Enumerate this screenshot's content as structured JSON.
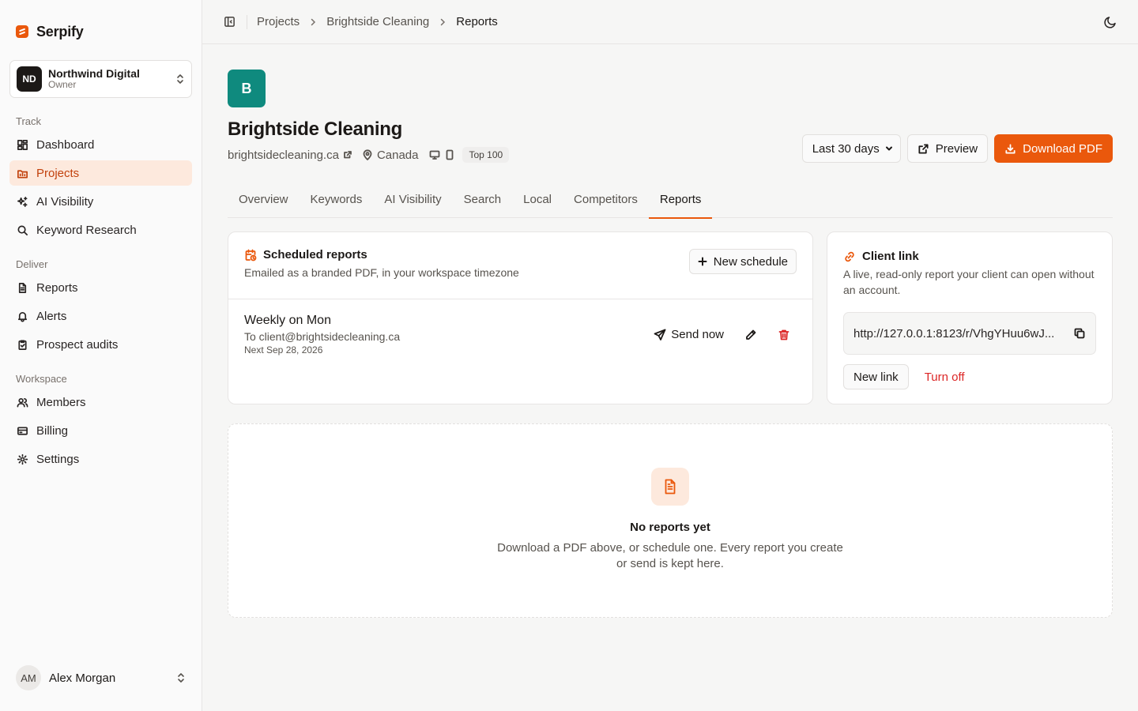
{
  "brand": {
    "name": "Serpify"
  },
  "workspace": {
    "initials": "ND",
    "name": "Northwind Digital",
    "role": "Owner"
  },
  "nav": {
    "track_label": "Track",
    "track": [
      {
        "label": "Dashboard",
        "icon": "dashboard-icon"
      },
      {
        "label": "Projects",
        "icon": "projects-icon",
        "active": true
      },
      {
        "label": "AI Visibility",
        "icon": "sparkle-icon"
      },
      {
        "label": "Keyword Research",
        "icon": "search-icon"
      }
    ],
    "deliver_label": "Deliver",
    "deliver": [
      {
        "label": "Reports",
        "icon": "document-icon"
      },
      {
        "label": "Alerts",
        "icon": "bell-icon"
      },
      {
        "label": "Prospect audits",
        "icon": "clipboard-icon"
      }
    ],
    "workspace_label": "Workspace",
    "workspace": [
      {
        "label": "Members",
        "icon": "users-icon"
      },
      {
        "label": "Billing",
        "icon": "credit-card-icon"
      },
      {
        "label": "Settings",
        "icon": "gear-icon"
      }
    ]
  },
  "user": {
    "initials": "AM",
    "name": "Alex Morgan"
  },
  "breadcrumb": [
    "Projects",
    "Brightside Cleaning",
    "Reports"
  ],
  "project": {
    "initial": "B",
    "title": "Brightside Cleaning",
    "domain": "brightsidecleaning.ca",
    "location": "Canada",
    "tag": "Top 100",
    "accent_color": "#0f8a7e"
  },
  "actions": {
    "range": "Last 30 days",
    "preview": "Preview",
    "download": "Download PDF"
  },
  "tabs": [
    "Overview",
    "Keywords",
    "AI Visibility",
    "Search",
    "Local",
    "Competitors",
    "Reports"
  ],
  "active_tab": "Reports",
  "scheduled": {
    "title": "Scheduled reports",
    "subtitle": "Emailed as a branded PDF, in your workspace timezone",
    "new_button": "New schedule",
    "item": {
      "name": "Weekly on Mon",
      "to": "To client@brightsidecleaning.ca",
      "next": "Next Sep 28, 2026",
      "send_now": "Send now"
    }
  },
  "client_link": {
    "title": "Client link",
    "subtitle": "A live, read-only report your client can open without an account.",
    "url": "http://127.0.0.1:8123/r/VhgYHuu6wJ...",
    "new_link": "New link",
    "turn_off": "Turn off"
  },
  "empty": {
    "title": "No reports yet",
    "description": "Download a PDF above, or schedule one. Every report you create or send is kept here."
  },
  "colors": {
    "accent": "#ea580c",
    "danger": "#dc2626",
    "active_bg": "#fde9dd"
  }
}
